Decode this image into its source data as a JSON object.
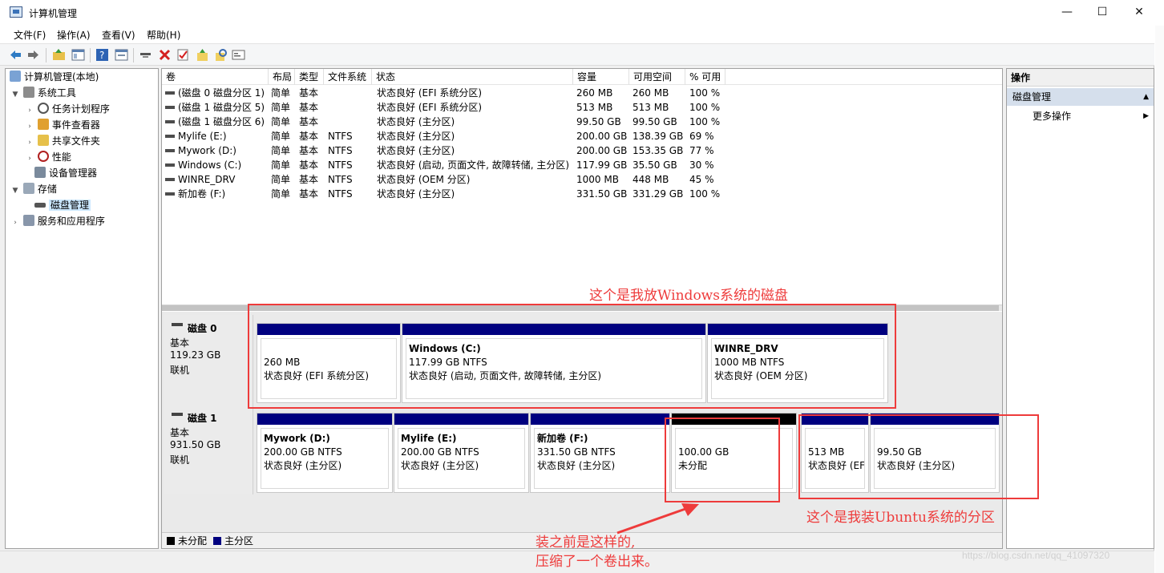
{
  "window": {
    "title": "计算机管理",
    "minimize": "—",
    "maximize": "☐",
    "close": "✕"
  },
  "menu": [
    "文件(F)",
    "操作(A)",
    "查看(V)",
    "帮助(H)"
  ],
  "toolbar_icons": [
    "back-icon",
    "forward-icon",
    "up-folder-icon",
    "console-tree-icon",
    "help-icon",
    "properties-icon",
    "connect-icon",
    "delete-icon",
    "check-icon",
    "import-icon",
    "search-icon",
    "properties-sheet-icon"
  ],
  "tree": {
    "root": "计算机管理(本地)",
    "system_tools": "系统工具",
    "task_scheduler": "任务计划程序",
    "event_viewer": "事件查看器",
    "shared_folders": "共享文件夹",
    "performance": "性能",
    "device_manager": "设备管理器",
    "storage": "存储",
    "disk_management": "磁盘管理",
    "services_apps": "服务和应用程序"
  },
  "columns": [
    "卷",
    "布局",
    "类型",
    "文件系统",
    "状态",
    "容量",
    "可用空间",
    "% 可用"
  ],
  "volumes": [
    [
      "(磁盘 0 磁盘分区 1)",
      "简单",
      "基本",
      "",
      "状态良好 (EFI 系统分区)",
      "260 MB",
      "260 MB",
      "100 %"
    ],
    [
      "(磁盘 1 磁盘分区 5)",
      "简单",
      "基本",
      "",
      "状态良好 (EFI 系统分区)",
      "513 MB",
      "513 MB",
      "100 %"
    ],
    [
      "(磁盘 1 磁盘分区 6)",
      "简单",
      "基本",
      "",
      "状态良好 (主分区)",
      "99.50 GB",
      "99.50 GB",
      "100 %"
    ],
    [
      "Mylife (E:)",
      "简单",
      "基本",
      "NTFS",
      "状态良好 (主分区)",
      "200.00 GB",
      "138.39 GB",
      "69 %"
    ],
    [
      "Mywork (D:)",
      "简单",
      "基本",
      "NTFS",
      "状态良好 (主分区)",
      "200.00 GB",
      "153.35 GB",
      "77 %"
    ],
    [
      "Windows (C:)",
      "简单",
      "基本",
      "NTFS",
      "状态良好 (启动, 页面文件, 故障转储, 主分区)",
      "117.99 GB",
      "35.50 GB",
      "30 %"
    ],
    [
      "WINRE_DRV",
      "简单",
      "基本",
      "NTFS",
      "状态良好 (OEM 分区)",
      "1000 MB",
      "448 MB",
      "45 %"
    ],
    [
      "新加卷 (F:)",
      "简单",
      "基本",
      "NTFS",
      "状态良好 (主分区)",
      "331.50 GB",
      "331.29 GB",
      "100 %"
    ]
  ],
  "disks": [
    {
      "name": "磁盘 0",
      "type": "基本",
      "size": "119.23 GB",
      "status": "联机",
      "partitions": [
        {
          "name": "",
          "size": "260 MB",
          "status": "状态良好 (EFI 系统分区)",
          "bar": "primary"
        },
        {
          "name": "Windows  (C:)",
          "size": "117.99 GB NTFS",
          "status": "状态良好 (启动, 页面文件, 故障转储, 主分区)",
          "bar": "primary"
        },
        {
          "name": "WINRE_DRV",
          "size": "1000 MB NTFS",
          "status": "状态良好 (OEM 分区)",
          "bar": "primary"
        }
      ]
    },
    {
      "name": "磁盘 1",
      "type": "基本",
      "size": "931.50 GB",
      "status": "联机",
      "partitions": [
        {
          "name": "Mywork  (D:)",
          "size": "200.00 GB NTFS",
          "status": "状态良好 (主分区)",
          "bar": "primary"
        },
        {
          "name": "Mylife  (E:)",
          "size": "200.00 GB NTFS",
          "status": "状态良好 (主分区)",
          "bar": "primary"
        },
        {
          "name": "新加卷  (F:)",
          "size": "331.50 GB NTFS",
          "status": "状态良好 (主分区)",
          "bar": "primary"
        },
        {
          "name": "",
          "size": "100.00 GB",
          "status": "未分配",
          "bar": "unallocated"
        },
        {
          "name": "",
          "size": "513 MB",
          "status": "状态良好 (EFI",
          "bar": "primary"
        },
        {
          "name": "",
          "size": "99.50 GB",
          "status": "状态良好 (主分区)",
          "bar": "primary"
        }
      ]
    }
  ],
  "legend": {
    "unallocated": "未分配",
    "primary": "主分区",
    "unallocated_color": "#000000",
    "primary_color": "#00007f"
  },
  "actions": {
    "header": "操作",
    "section": "磁盘管理",
    "more": "更多操作"
  },
  "annotations": {
    "windows_disk": "这个是我放Windows系统的磁盘",
    "ubuntu_partition": "这个是我装Ubuntu系统的分区",
    "before_line1": "装之前是这样的,",
    "before_line2": "压缩了一个卷出来。"
  },
  "watermark": "https://blog.csdn.net/qq_41097320",
  "accent_color": "#ee3b3b"
}
